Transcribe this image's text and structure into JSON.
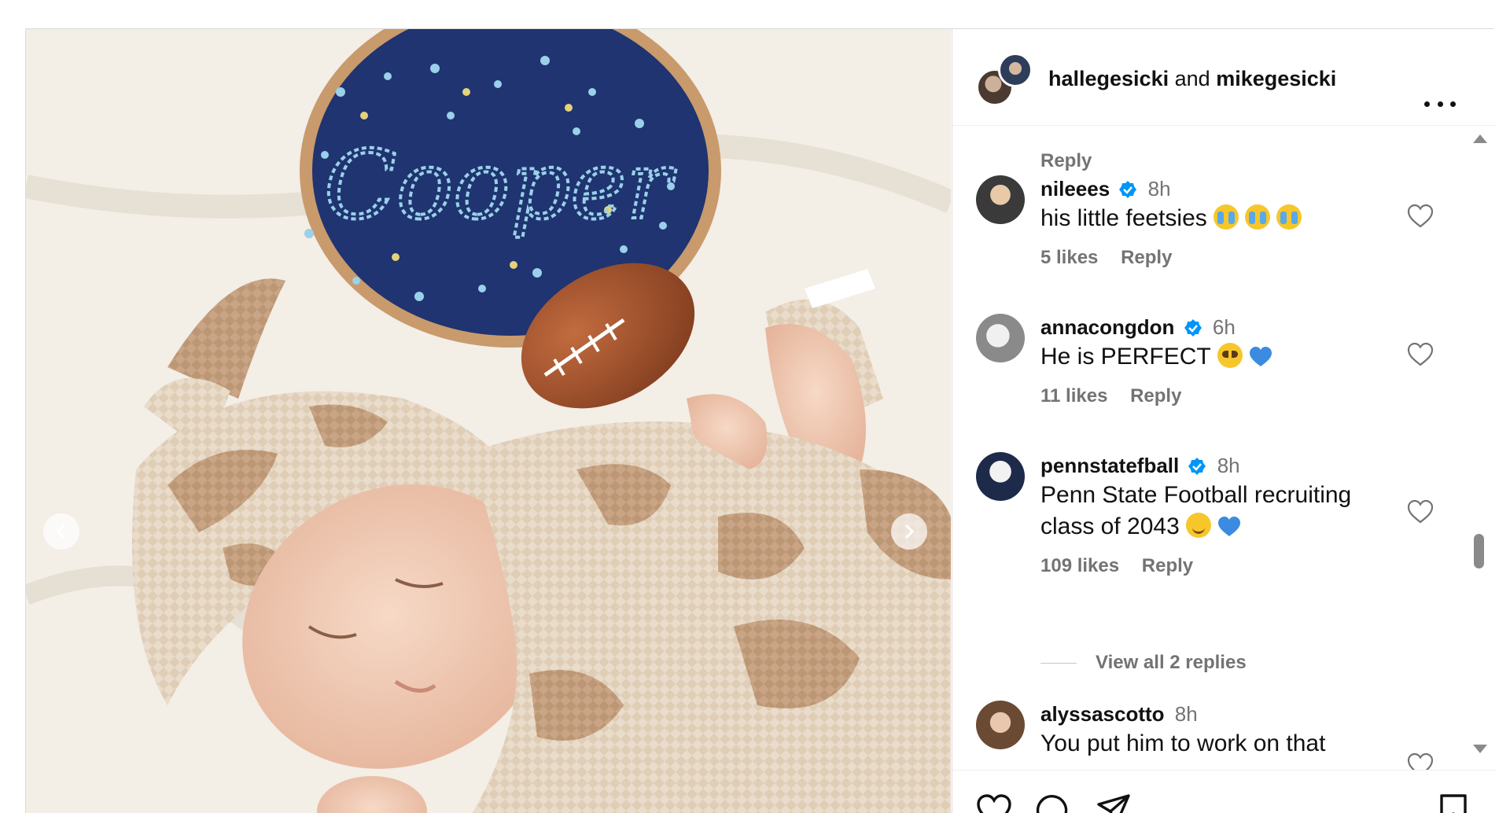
{
  "post": {
    "owner_1": "hallegesicki",
    "joiner": "and",
    "owner_2": "mikegesicki",
    "image": {
      "description_icon": "photo-icon",
      "hoop_text": "Cooper"
    }
  },
  "comments_section": {
    "top_reply_label": "Reply",
    "comments": [
      {
        "username": "nileees",
        "verified": true,
        "time": "8h",
        "text": "his little feetsies",
        "emojis": [
          "crying-face",
          "crying-face",
          "crying-face"
        ],
        "likes": "5 likes",
        "reply": "Reply"
      },
      {
        "username": "annacongdon",
        "verified": true,
        "time": "6h",
        "text": "He is PERFECT",
        "emojis": [
          "pleading-face",
          "blue-heart"
        ],
        "likes": "11 likes",
        "reply": "Reply"
      },
      {
        "username": "pennstatefball",
        "verified": true,
        "time": "8h",
        "text_line1": "Penn State Football recruiting",
        "text_line2": "class of 2043",
        "emojis": [
          "smiling-face",
          "blue-heart"
        ],
        "likes": "109 likes",
        "reply": "Reply",
        "view_replies": "View all 2 replies"
      },
      {
        "username": "alyssascotto",
        "verified": false,
        "time": "8h",
        "text": "You put him to work on that"
      }
    ]
  },
  "colors": {
    "verified_blue": "#0095f6",
    "meta_gray": "#737373",
    "hoop_navy": "#1f3470",
    "football_brown": "#9a4e2a",
    "knit_tan": "#c9a585"
  },
  "icons": {
    "more": "more-options-icon",
    "like": "heart-icon",
    "comment": "comment-icon",
    "share": "paper-plane-icon",
    "save": "bookmark-icon",
    "prev": "chevron-left-icon",
    "next": "chevron-right-icon"
  }
}
